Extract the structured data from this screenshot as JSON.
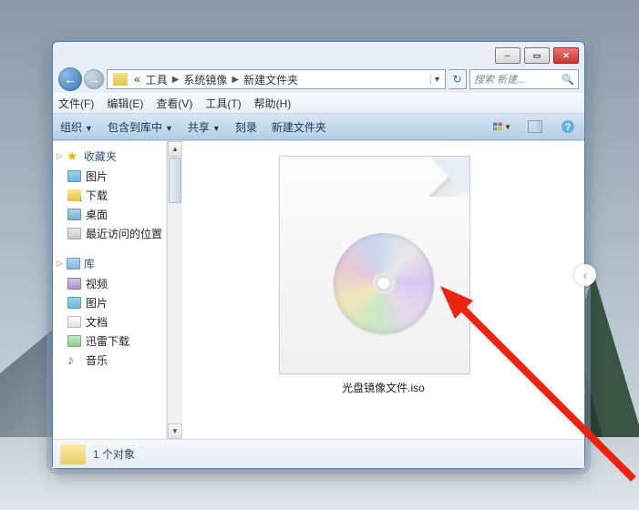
{
  "breadcrumbs": {
    "root_indicator": "«",
    "p1": "工具",
    "p2": "系统镜像",
    "p3": "新建文件夹"
  },
  "search": {
    "placeholder": "搜索 新建..."
  },
  "menu": {
    "file": "文件(F)",
    "edit": "编辑(E)",
    "view": "查看(V)",
    "tools": "工具(T)",
    "help": "帮助(H)"
  },
  "toolbar": {
    "organize": "组织",
    "include": "包含到库中",
    "share": "共享",
    "burn": "刻录",
    "newfolder": "新建文件夹"
  },
  "sidebar": {
    "favorites": {
      "label": "收藏夹",
      "items": [
        {
          "key": "pictures",
          "label": "图片"
        },
        {
          "key": "downloads",
          "label": "下载"
        },
        {
          "key": "desktop",
          "label": "桌面"
        },
        {
          "key": "recent",
          "label": "最近访问的位置"
        }
      ]
    },
    "libraries": {
      "label": "库",
      "items": [
        {
          "key": "videos",
          "label": "视频"
        },
        {
          "key": "pictures2",
          "label": "图片"
        },
        {
          "key": "documents",
          "label": "文档"
        },
        {
          "key": "xunlei",
          "label": "迅雷下载"
        },
        {
          "key": "music",
          "label": "音乐"
        }
      ]
    }
  },
  "file": {
    "name": "光盘镜像文件.iso"
  },
  "status": {
    "text": "1 个对象"
  }
}
